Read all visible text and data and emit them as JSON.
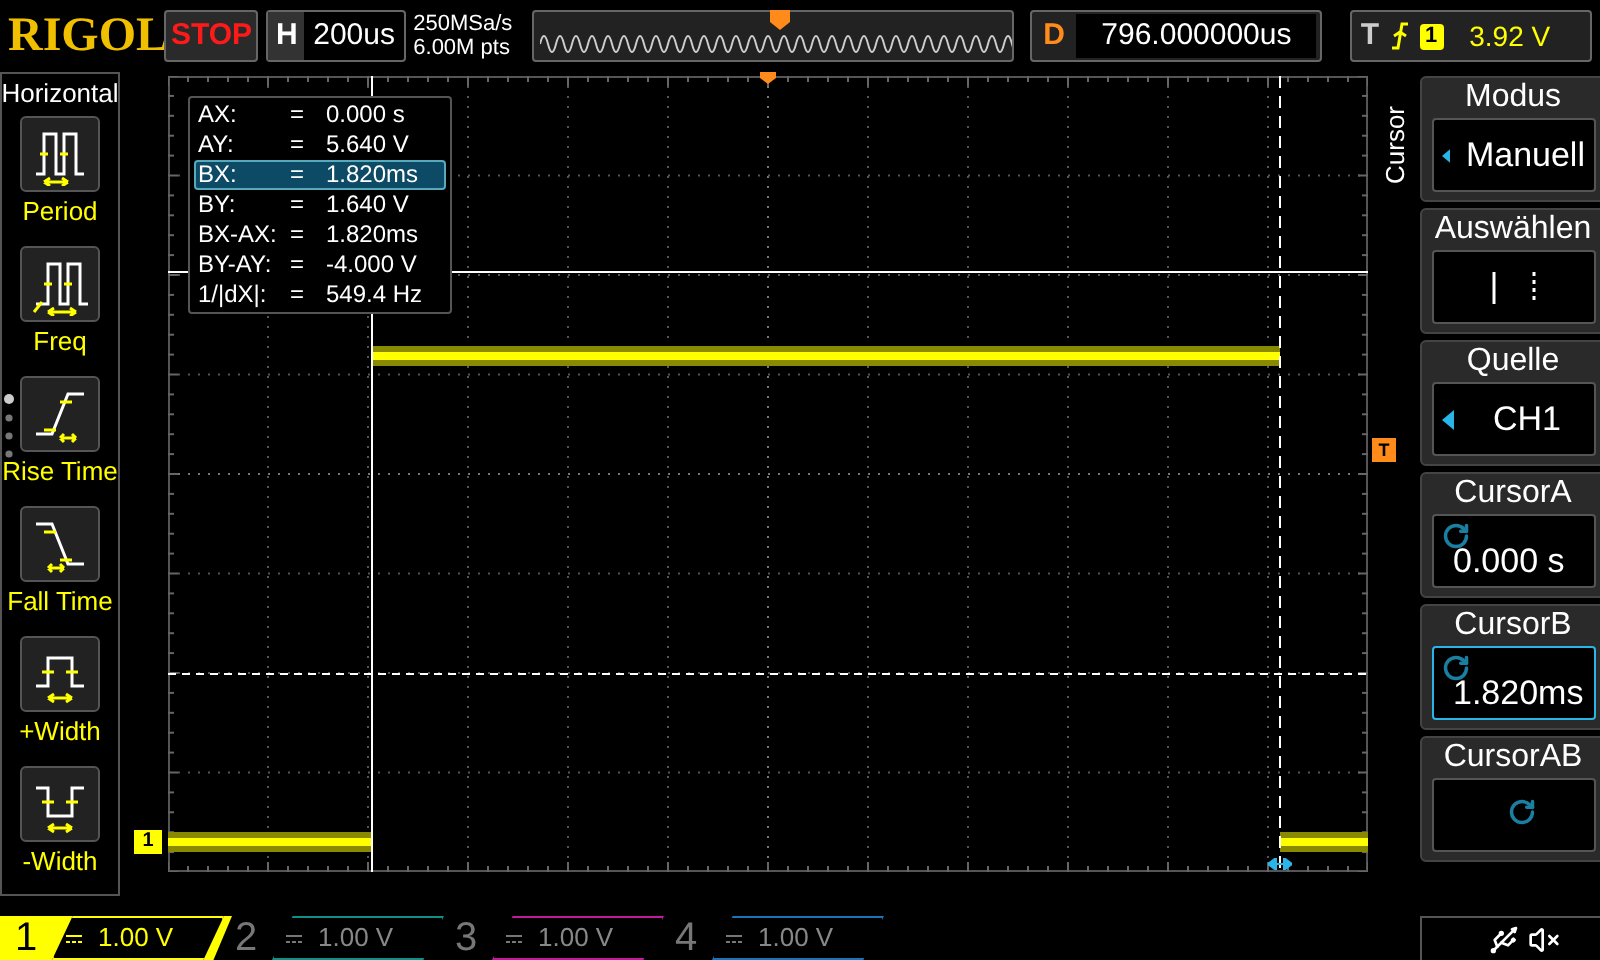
{
  "brand": "RIGOL",
  "run_state": {
    "label": "STOP",
    "stopped": true
  },
  "horizontal": {
    "label": "H",
    "timebase": "200us"
  },
  "acquisition": {
    "sample_rate": "250MSa/s",
    "memory_depth": "6.00M pts"
  },
  "delay": {
    "label": "D",
    "value": "796.000000us"
  },
  "trigger": {
    "label": "T",
    "source": "1",
    "level": "3.92 V"
  },
  "measure_menu": {
    "title": "Horizontal",
    "items": [
      {
        "label": "Period",
        "kind": "period"
      },
      {
        "label": "Freq",
        "kind": "freq"
      },
      {
        "label": "Rise Time",
        "kind": "rise"
      },
      {
        "label": "Fall Time",
        "kind": "fall"
      },
      {
        "label": "+Width",
        "kind": "pwidth"
      },
      {
        "label": "-Width",
        "kind": "nwidth"
      }
    ]
  },
  "cursor_readout": [
    {
      "label": "AX:",
      "eq": "=",
      "value": "0.000 s",
      "selected": false
    },
    {
      "label": "AY:",
      "eq": "=",
      "value": "5.640 V",
      "selected": false
    },
    {
      "label": "BX:",
      "eq": "=",
      "value": "1.820ms",
      "selected": true
    },
    {
      "label": "BY:",
      "eq": "=",
      "value": "1.640 V",
      "selected": false
    },
    {
      "label": "BX-AX:",
      "eq": "=",
      "value": "1.820ms",
      "selected": false
    },
    {
      "label": "BY-AY:",
      "eq": "=",
      "value": "-4.000 V",
      "selected": false
    },
    {
      "label": "1/|dX|:",
      "eq": "=",
      "value": "549.4 Hz",
      "selected": false
    }
  ],
  "channel_marker": "1",
  "trigger_marker": "T",
  "cursor_menu": {
    "title": "Cursor",
    "items": [
      {
        "title": "Modus",
        "value": "Manuell",
        "kind": "select",
        "selected": false
      },
      {
        "title": "Auswählen",
        "kind": "lines",
        "selected": false
      },
      {
        "title": "Quelle",
        "value": "CH1",
        "kind": "select",
        "selected": false
      },
      {
        "title": "CursorA",
        "value": "0.000 s",
        "kind": "knob",
        "selected": false
      },
      {
        "title": "CursorB",
        "value": "1.820ms",
        "kind": "knob",
        "selected": true
      },
      {
        "title": "CursorAB",
        "kind": "knob",
        "selected": false
      }
    ]
  },
  "channels": [
    {
      "number": "1",
      "scale": "1.00 V",
      "on": true,
      "color": "#ffff00"
    },
    {
      "number": "2",
      "scale": "1.00 V",
      "on": false,
      "color": "#0f8f88"
    },
    {
      "number": "3",
      "scale": "1.00 V",
      "on": false,
      "color": "#c21a9b"
    },
    {
      "number": "4",
      "scale": "1.00 V",
      "on": false,
      "color": "#1a73b8"
    }
  ]
}
